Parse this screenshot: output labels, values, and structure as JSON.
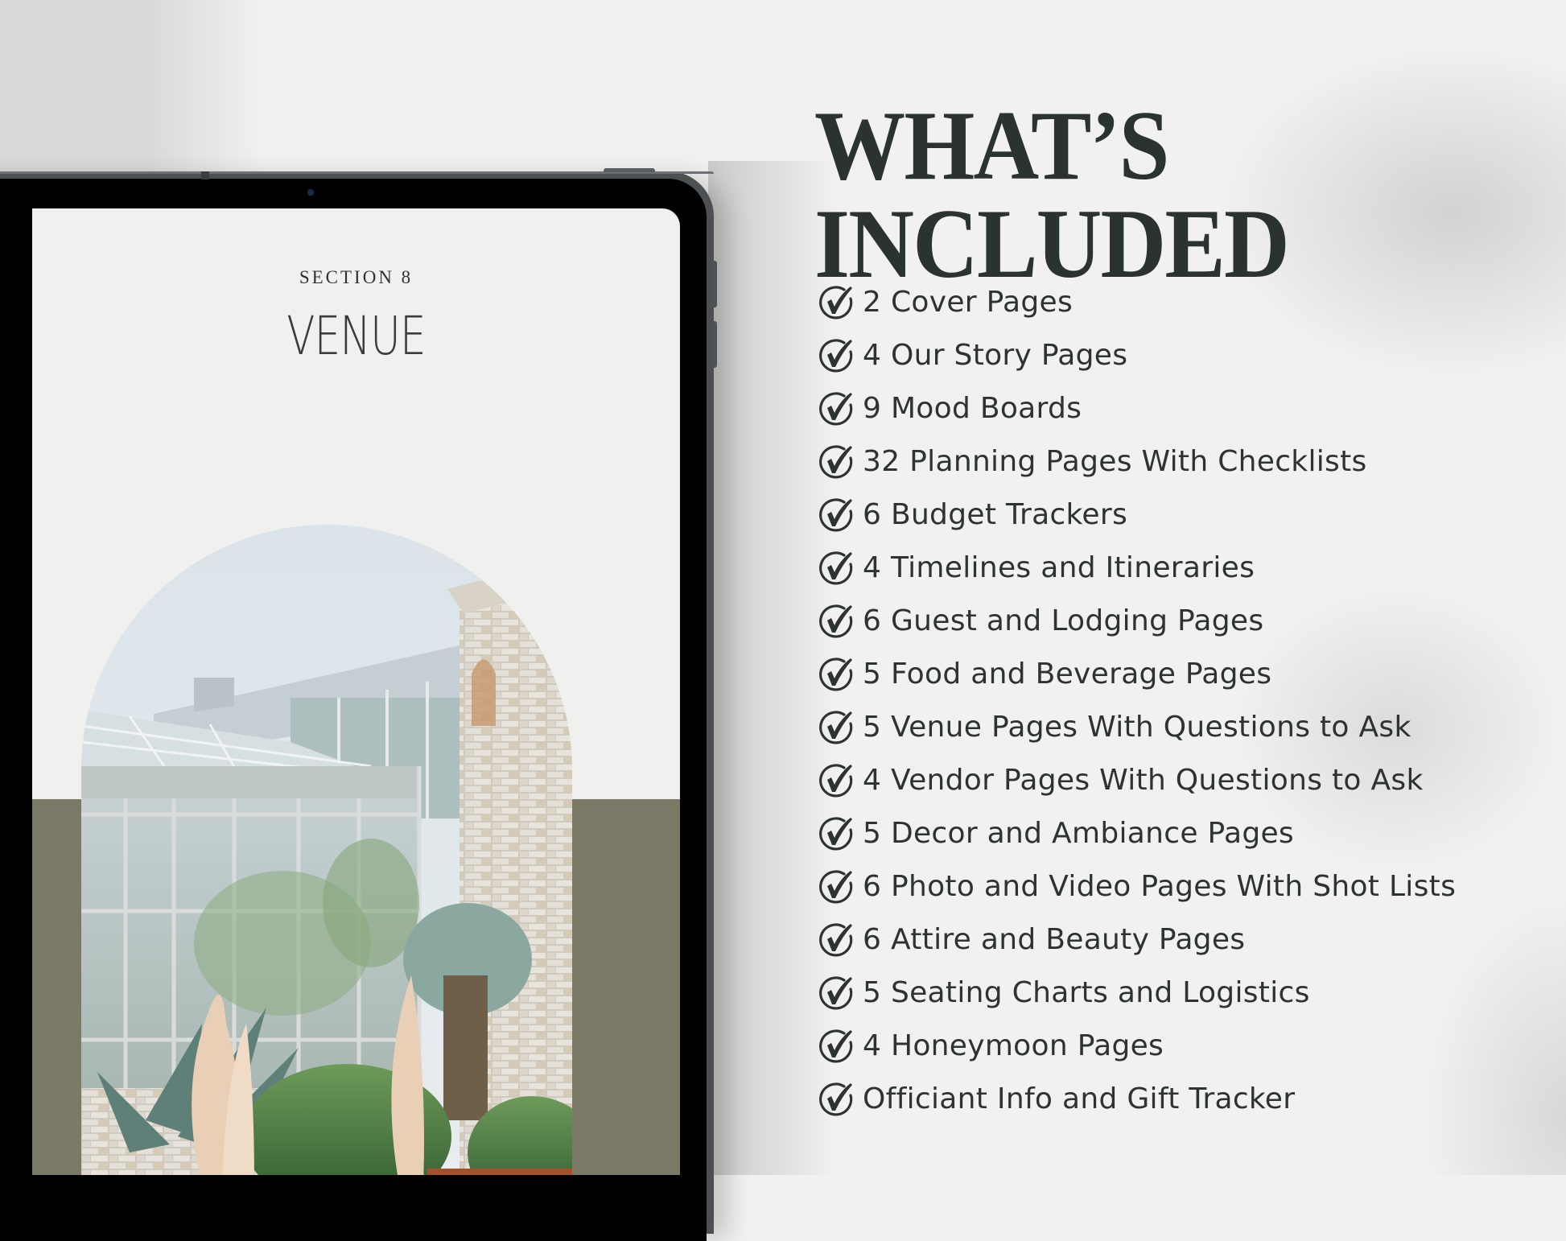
{
  "heading": {
    "line1": "WHAT’S",
    "line2": "INCLUDED"
  },
  "tablet": {
    "section_label": "SECTION 8",
    "title": "VENUE",
    "photo_description": "greenhouse conservatory with stone tower and pampas grass"
  },
  "checklist": {
    "icon": "circle-check-icon",
    "items": [
      "2 Cover Pages",
      "4 Our Story Pages",
      "9 Mood Boards",
      "32 Planning Pages With Checklists",
      "6 Budget Trackers",
      "4 Timelines and Itineraries",
      "6 Guest and Lodging Pages",
      "5 Food and Beverage Pages",
      "5 Venue Pages With Questions to Ask",
      "4 Vendor Pages With Questions to Ask",
      "5 Decor and Ambiance Pages",
      "6 Photo and Video Pages With Shot Lists",
      "6 Attire and Beauty Pages",
      "5 Seating Charts and Logistics",
      "4 Honeymoon Pages",
      "Officiant Info and Gift Tracker"
    ]
  },
  "colors": {
    "background": "#f1f1ef",
    "text_dark": "#2b3232",
    "olive": "#7b7a67",
    "tablet_rim": "#4c5052",
    "bezel": "#000000"
  }
}
